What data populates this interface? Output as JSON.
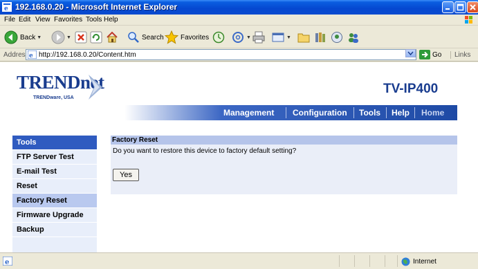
{
  "window": {
    "title": "192.168.0.20 - Microsoft Internet Explorer"
  },
  "menu": {
    "items": [
      "File",
      "Edit",
      "View",
      "Favorites",
      "Tools",
      "Help"
    ]
  },
  "toolbar": {
    "back_label": "Back",
    "search_label": "Search",
    "favorites_label": "Favorites"
  },
  "address": {
    "label": "Address",
    "url": "http://192.168.0.20/Content.htm",
    "go_label": "Go",
    "links_label": "Links"
  },
  "header": {
    "brand": "TRENDnet",
    "tagline": "TRENDware, USA",
    "model": "TV-IP400"
  },
  "nav": {
    "items": [
      "Management",
      "Configuration",
      "Tools",
      "Help",
      "Home"
    ]
  },
  "sidebar": {
    "header": "Tools",
    "items": [
      "FTP Server Test",
      "E-mail Test",
      "Reset",
      "Factory Reset",
      "Firmware Upgrade",
      "Backup"
    ],
    "active": "Factory Reset"
  },
  "panel": {
    "title": "Factory Reset",
    "question": "Do you want to restore this device to factory default setting?",
    "yes_label": "Yes"
  },
  "status": {
    "zone": "Internet"
  },
  "colors": {
    "brand_blue": "#1a3d8f",
    "nav_blue": "#2f5bc0",
    "titlebar_blue": "#0548d0"
  }
}
